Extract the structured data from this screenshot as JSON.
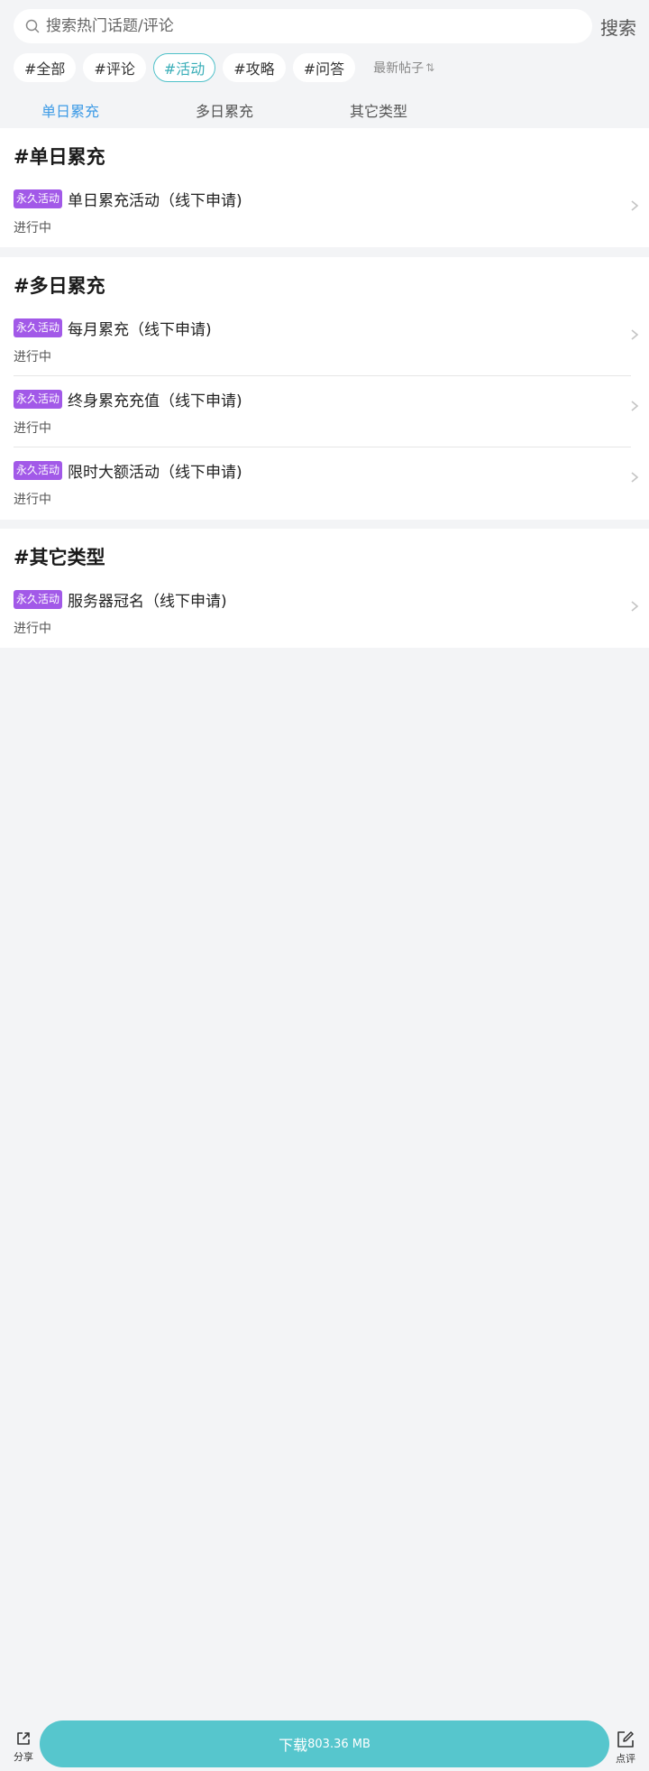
{
  "search": {
    "placeholder": "搜索热门话题/评论",
    "button_label": "搜索"
  },
  "tags": [
    {
      "label": "#全部",
      "active": false
    },
    {
      "label": "#评论",
      "active": false
    },
    {
      "label": "#活动",
      "active": true
    },
    {
      "label": "#攻略",
      "active": false
    },
    {
      "label": "#问答",
      "active": false
    }
  ],
  "sort": {
    "label": "最新帖子",
    "icon": "sort-arrows-icon"
  },
  "sub_tabs": [
    {
      "label": "单日累充",
      "active": true
    },
    {
      "label": "多日累充",
      "active": false
    },
    {
      "label": "其它类型",
      "active": false
    }
  ],
  "sections": [
    {
      "title": "#单日累充",
      "items": [
        {
          "badge": "永久活动",
          "title": "单日累充活动（线下申请)",
          "status": "进行中"
        }
      ]
    },
    {
      "title": "#多日累充",
      "items": [
        {
          "badge": "永久活动",
          "title": "每月累充（线下申请)",
          "status": "进行中"
        },
        {
          "badge": "永久活动",
          "title": "终身累充充值（线下申请)",
          "status": "进行中"
        },
        {
          "badge": "永久活动",
          "title": "限时大额活动（线下申请)",
          "status": "进行中"
        }
      ]
    },
    {
      "title": "#其它类型",
      "items": [
        {
          "badge": "永久活动",
          "title": "服务器冠名（线下申请)",
          "status": "进行中"
        }
      ]
    }
  ],
  "bottom": {
    "share_label": "分享",
    "review_label": "点评",
    "download_label": "下载",
    "download_size": "803.36 MB"
  },
  "colors": {
    "accent_teal": "#56c6cd",
    "tab_active_blue": "#3e9be6",
    "badge_purple": "#a259e8",
    "background": "#f3f4f6"
  }
}
